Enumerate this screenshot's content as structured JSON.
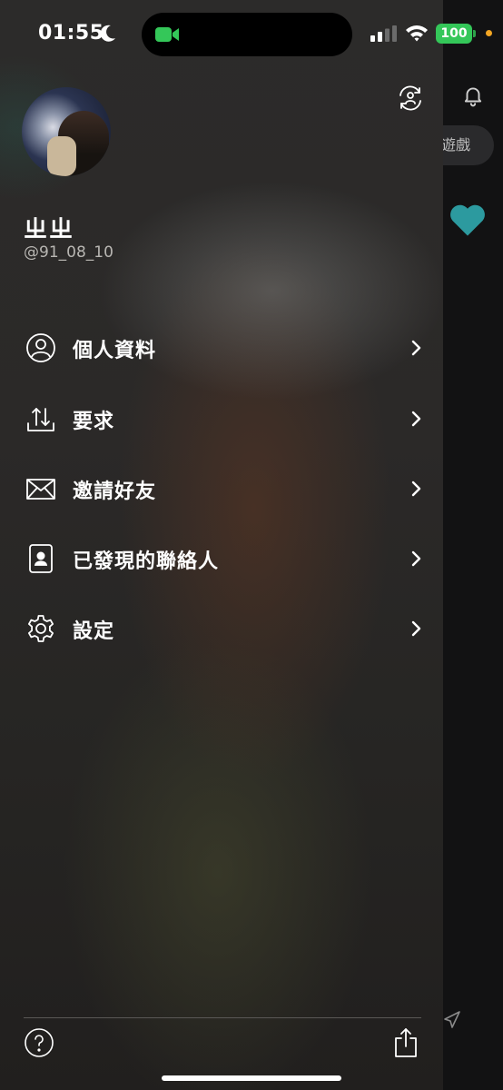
{
  "status_bar": {
    "time": "01:55",
    "battery": "100",
    "icons": [
      "moon-icon",
      "facetime-icon",
      "signal-icon",
      "wifi-icon",
      "battery-icon"
    ]
  },
  "profile": {
    "display_name": "ㄓㄓ",
    "username": "@91_08_10"
  },
  "menu": {
    "items": [
      {
        "label": "個人資料",
        "icon": "person-icon"
      },
      {
        "label": "要求",
        "icon": "upload-download-icon"
      },
      {
        "label": "邀請好友",
        "icon": "mail-icon"
      },
      {
        "label": "已發現的聯絡人",
        "icon": "contact-card-icon"
      },
      {
        "label": "設定",
        "icon": "gear-icon"
      }
    ]
  },
  "background_app": {
    "pill_label": "遊戲"
  },
  "colors": {
    "accent_heart": "#2c9a9f",
    "battery": "#34c759",
    "mic_dot": "#f5a623"
  }
}
